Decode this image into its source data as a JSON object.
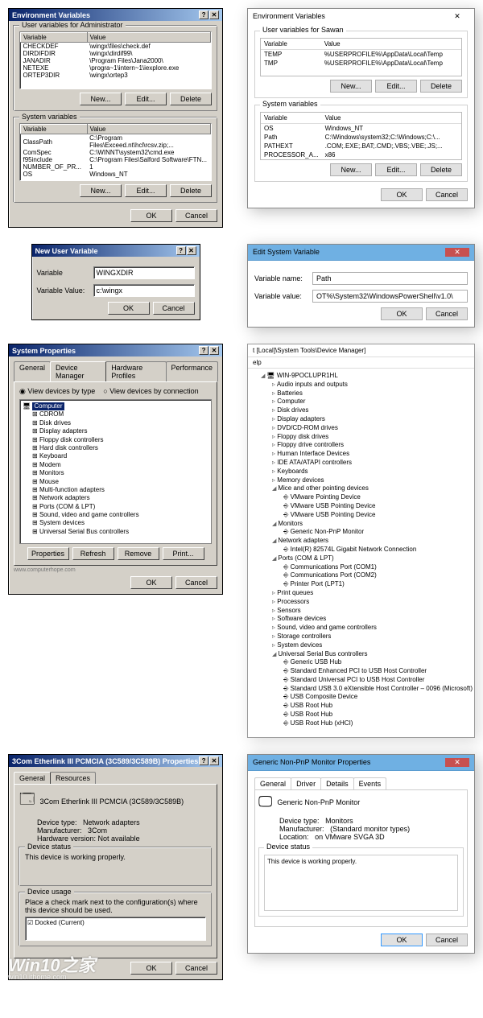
{
  "row1": {
    "left": {
      "title": "Environment Variables",
      "group1": "User variables for Administrator",
      "cols": [
        "Variable",
        "Value"
      ],
      "userVars": [
        [
          "CHECKDEF",
          "\\wingx\\files\\check.def"
        ],
        [
          "DIRDIFDIR",
          "\\wingx\\dirdif99\\"
        ],
        [
          "JANADIR",
          "\\Program Files\\Jana2000\\"
        ],
        [
          "NETEXE",
          "\\progra~1\\intern~1\\iexplore.exe"
        ],
        [
          "ORTEP3DIR",
          "\\wingx\\ortep3"
        ]
      ],
      "group2": "System variables",
      "sysVars": [
        [
          "ClassPath",
          "C:\\Program Files\\Exceed.nt\\hcl\\rcsv.zip;..."
        ],
        [
          "ComSpec",
          "C:\\WINNT\\system32\\cmd.exe"
        ],
        [
          "f95include",
          "C:\\Program Files\\Salford Software\\FTN..."
        ],
        [
          "NUMBER_OF_PR...",
          "1"
        ],
        [
          "OS",
          "Windows_NT"
        ]
      ],
      "btns": {
        "new": "New...",
        "edit": "Edit...",
        "del": "Delete",
        "ok": "OK",
        "cancel": "Cancel"
      }
    },
    "right": {
      "title": "Environment Variables",
      "group1": "User variables for Sawan",
      "cols": [
        "Variable",
        "Value"
      ],
      "userVars": [
        [
          "TEMP",
          "%USERPROFILE%\\AppData\\Local\\Temp"
        ],
        [
          "TMP",
          "%USERPROFILE%\\AppData\\Local\\Temp"
        ]
      ],
      "group2": "System variables",
      "sysVars": [
        [
          "OS",
          "Windows_NT"
        ],
        [
          "Path",
          "C:\\Windows\\system32;C:\\Windows;C:\\..."
        ],
        [
          "PATHEXT",
          ".COM;.EXE;.BAT;.CMD;.VBS;.VBE;.JS;..."
        ],
        [
          "PROCESSOR_A...",
          "x86"
        ]
      ],
      "btns": {
        "new": "New...",
        "edit": "Edit...",
        "del": "Delete",
        "ok": "OK",
        "cancel": "Cancel"
      }
    }
  },
  "row2": {
    "left": {
      "title": "New User Variable",
      "nameLbl": "Variable",
      "nameVal": "WINGXDIR",
      "valLbl": "Variable Value:",
      "valVal": "c:\\wingx",
      "ok": "OK",
      "cancel": "Cancel"
    },
    "right": {
      "title": "Edit System Variable",
      "nameLbl": "Variable name:",
      "nameVal": "Path",
      "valLbl": "Variable value:",
      "valVal": "OT%\\System32\\WindowsPowerShell\\v1.0\\",
      "ok": "OK",
      "cancel": "Cancel"
    }
  },
  "row3": {
    "left": {
      "title": "System Properties",
      "tabs": [
        "General",
        "Device Manager",
        "Hardware Profiles",
        "Performance"
      ],
      "r1": "View devices by type",
      "r2": "View devices by connection",
      "root": "Computer",
      "items": [
        "CDROM",
        "Disk drives",
        "Display adapters",
        "Floppy disk controllers",
        "Hard disk controllers",
        "Keyboard",
        "Modem",
        "Monitors",
        "Mouse",
        "Multi-function adapters",
        "Network adapters",
        "Ports (COM & LPT)",
        "Sound, video and game controllers",
        "System devices",
        "Universal Serial Bus controllers"
      ],
      "btns": {
        "prop": "Properties",
        "ref": "Refresh",
        "rem": "Remove",
        "print": "Print..."
      },
      "ok": "OK",
      "cancel": "Cancel",
      "footer": "www.computerhope.com"
    },
    "right": {
      "crumb": "t [Local]\\System Tools\\Device Manager]",
      "menu": "elp",
      "root": "WIN-9POCLUPR1HL",
      "top": [
        "Audio inputs and outputs",
        "Batteries",
        "Computer",
        "Disk drives",
        "Display adapters",
        "DVD/CD-ROM drives",
        "Floppy disk drives",
        "Floppy drive controllers",
        "Human Interface Devices",
        "IDE ATA/ATAPI controllers",
        "Keyboards",
        "Memory devices"
      ],
      "mice": {
        "label": "Mice and other pointing devices",
        "items": [
          "VMware Pointing Device",
          "VMware USB Pointing Device",
          "VMware USB Pointing Device"
        ]
      },
      "mon": {
        "label": "Monitors",
        "items": [
          "Generic Non-PnP Monitor"
        ]
      },
      "net": {
        "label": "Network adapters",
        "items": [
          "Intel(R) 82574L Gigabit Network Connection"
        ]
      },
      "ports": {
        "label": "Ports (COM & LPT)",
        "items": [
          "Communications Port (COM1)",
          "Communications Port (COM2)",
          "Printer Port (LPT1)"
        ]
      },
      "mid": [
        "Print queues",
        "Processors",
        "Sensors",
        "Software devices",
        "Sound, video and game controllers",
        "Storage controllers",
        "System devices"
      ],
      "usb": {
        "label": "Universal Serial Bus controllers",
        "items": [
          "Generic USB Hub",
          "Standard Enhanced PCI to USB Host Controller",
          "Standard Universal PCI to USB Host Controller",
          "Standard USB 3.0 eXtensible Host Controller – 0096 (Microsoft)",
          "USB Composite Device",
          "USB Root Hub",
          "USB Root Hub",
          "USB Root Hub (xHCI)"
        ]
      }
    }
  },
  "row4": {
    "left": {
      "title": "3Com Etherlink III PCMCIA (3C589/3C589B) Properties",
      "tabs": [
        "General",
        "Resources"
      ],
      "dev": "3Com Etherlink III PCMCIA (3C589/3C589B)",
      "typeLbl": "Device type:",
      "type": "Network adapters",
      "mfgLbl": "Manufacturer:",
      "mfg": "3Com",
      "hwLbl": "Hardware version:",
      "hw": "Not available",
      "statusCap": "Device status",
      "status": "This device is working properly.",
      "usageCap": "Device usage",
      "usageTxt": "Place a check mark next to the configuration(s) where this device should be used.",
      "usageItem": "Docked (Current)",
      "ok": "OK",
      "cancel": "Cancel"
    },
    "right": {
      "title": "Generic Non-PnP Monitor Properties",
      "tabs": [
        "General",
        "Driver",
        "Details",
        "Events"
      ],
      "dev": "Generic Non-PnP Monitor",
      "typeLbl": "Device type:",
      "type": "Monitors",
      "mfgLbl": "Manufacturer:",
      "mfg": "(Standard monitor types)",
      "locLbl": "Location:",
      "loc": "on VMware SVGA 3D",
      "statusCap": "Device status",
      "status": "This device is working properly.",
      "ok": "OK",
      "cancel": "Cancel"
    }
  },
  "watermark": {
    "big": "Win10之家",
    "small": "win10.ithome.com"
  }
}
